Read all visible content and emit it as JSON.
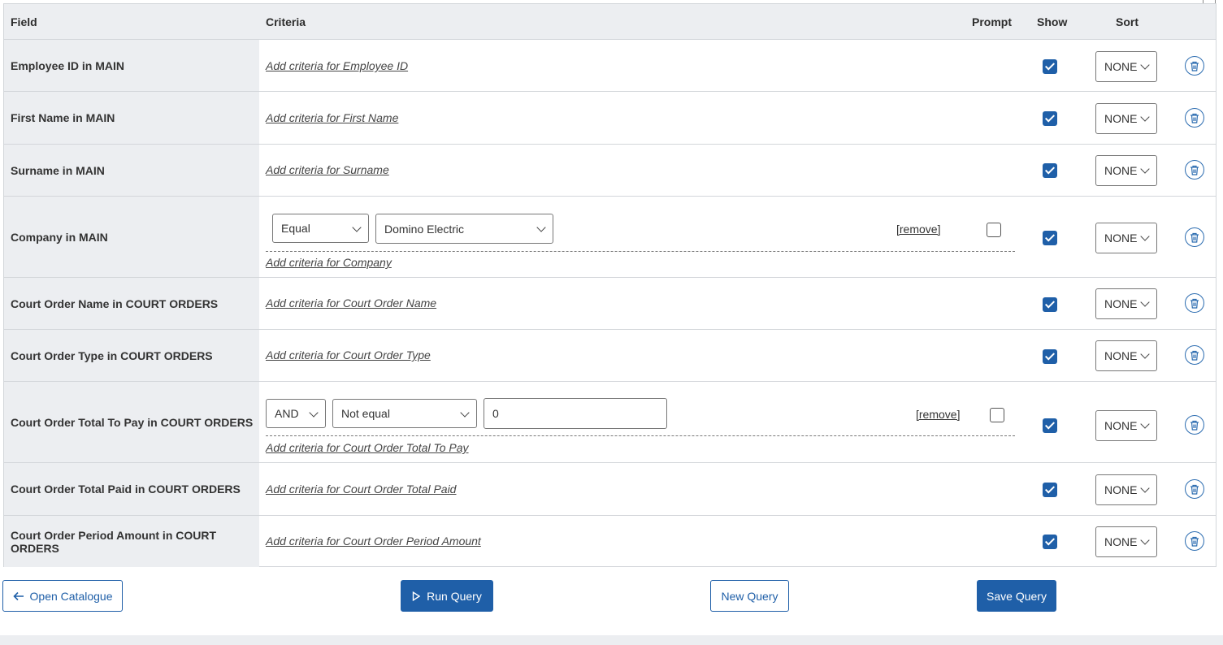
{
  "header": {
    "field": "Field",
    "criteria": "Criteria",
    "prompt": "Prompt",
    "show": "Show",
    "sort": "Sort"
  },
  "rows": [
    {
      "field": "Employee ID in MAIN",
      "add_link": "Add criteria for Employee ID",
      "show": true,
      "sort": "NONE"
    },
    {
      "field": "First Name in MAIN",
      "add_link": "Add criteria for First Name",
      "show": true,
      "sort": "NONE"
    },
    {
      "field": "Surname in MAIN",
      "add_link": "Add criteria for Surname",
      "show": true,
      "sort": "NONE"
    },
    {
      "field": "Company in MAIN",
      "add_link": "Add criteria for Company",
      "show": true,
      "sort": "NONE",
      "criterion": {
        "operator": "Equal",
        "value": "Domino Electric",
        "remove": "[remove]",
        "prompt": false
      }
    },
    {
      "field": "Court Order Name in COURT ORDERS",
      "add_link": "Add criteria for Court Order Name",
      "show": true,
      "sort": "NONE"
    },
    {
      "field": "Court Order Type in COURT ORDERS",
      "add_link": "Add criteria for Court Order Type",
      "show": true,
      "sort": "NONE"
    },
    {
      "field": "Court Order Total To Pay in COURT ORDERS",
      "add_link": "Add criteria for Court Order Total To Pay",
      "show": true,
      "sort": "NONE",
      "criterion": {
        "conjunction": "AND",
        "operator": "Not equal",
        "value": "0",
        "remove": "[remove]",
        "prompt": false
      }
    },
    {
      "field": "Court Order Total Paid in COURT ORDERS",
      "add_link": "Add criteria for Court Order Total Paid",
      "show": true,
      "sort": "NONE"
    },
    {
      "field": "Court Order Period Amount in COURT ORDERS",
      "add_link": "Add criteria for Court Order Period Amount",
      "show": true,
      "sort": "NONE"
    }
  ],
  "buttons": {
    "open_catalogue": "Open Catalogue",
    "run_query": "Run Query",
    "new_query": "New Query",
    "save_query": "Save Query"
  },
  "icons": {
    "open_catalogue": "arrow-left-icon",
    "run_query": "play-icon",
    "delete": "trash-icon"
  },
  "colors": {
    "accent": "#1f5fa8",
    "header_bg": "#eceef1",
    "border": "#d3d6da"
  }
}
